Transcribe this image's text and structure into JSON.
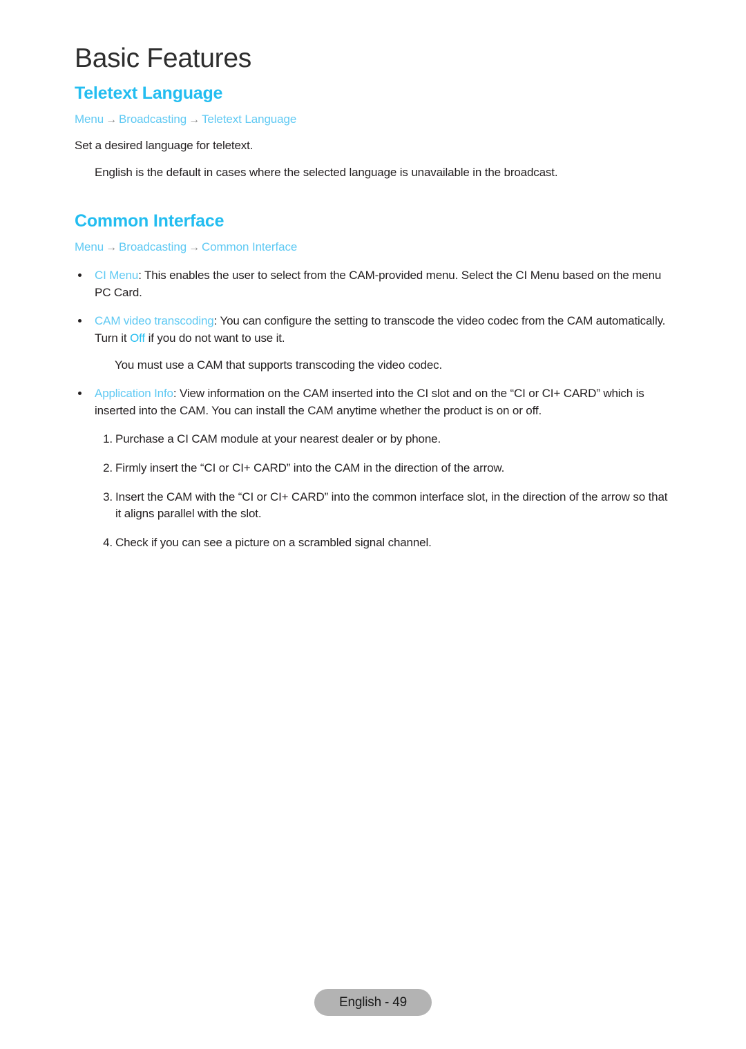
{
  "page": {
    "chapter_title": "Basic Features",
    "footer_label": "English - 49",
    "accent_color": "#23bdf0",
    "link_color": "#5fc9f3",
    "text_color": "#231f20",
    "badge_color": "#b3b3b3"
  },
  "sections": [
    {
      "heading": "Teletext Language",
      "breadcrumb": {
        "items": [
          "Menu",
          "Broadcasting",
          "Teletext Language"
        ],
        "separator": "→"
      },
      "body": "Set a desired language for teletext.",
      "note": "English is the default in cases where the selected language is unavailable in the broadcast."
    },
    {
      "heading": "Common Interface",
      "breadcrumb": {
        "items": [
          "Menu",
          "Broadcasting",
          "Common Interface"
        ],
        "separator": "→"
      },
      "bullets": [
        {
          "term": "CI Menu",
          "text": ": This enables the user to select from the CAM-provided menu. Select the CI Menu based on the menu PC Card."
        },
        {
          "term": "CAM video transcoding",
          "text": ": You can configure the setting to transcode the video codec from the CAM automatically. Turn it ",
          "keyword": "Off",
          "text_after": " if you do not want to use it.",
          "note": "You must use a CAM that supports transcoding the video codec."
        },
        {
          "term": "Application Info",
          "text": ": View information on the CAM inserted into the CI slot and on the “CI or CI+ CARD” which is inserted into the CAM. You can install the CAM anytime whether the product is on or off."
        }
      ],
      "steps": [
        {
          "num": "1.",
          "text": "Purchase a CI CAM module at your nearest dealer or by phone."
        },
        {
          "num": "2.",
          "text": "Firmly insert the “CI or CI+ CARD” into the CAM in the direction of the arrow."
        },
        {
          "num": "3.",
          "text": "Insert the CAM with the “CI or CI+ CARD” into the common interface slot, in the direction of the arrow so that it aligns parallel with the slot."
        },
        {
          "num": "4.",
          "text": "Check if you can see a picture on a scrambled signal channel."
        }
      ]
    }
  ]
}
